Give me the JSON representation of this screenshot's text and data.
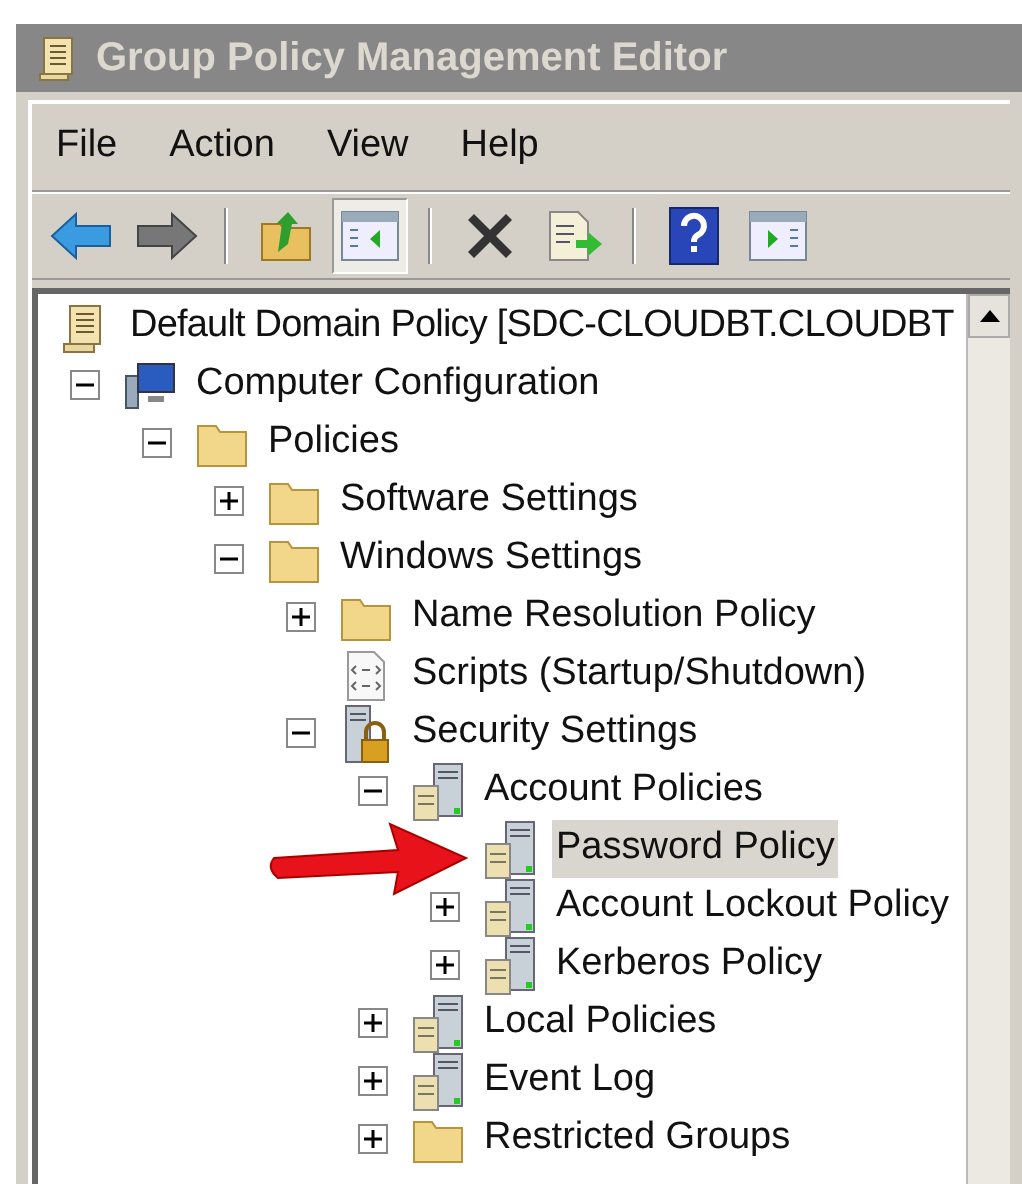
{
  "window": {
    "title": "Group Policy Management Editor"
  },
  "menu": [
    "File",
    "Action",
    "View",
    "Help"
  ],
  "toolbar": [
    {
      "kind": "back",
      "disabled": false
    },
    {
      "kind": "forward",
      "disabled": true
    },
    {
      "kind": "separator"
    },
    {
      "kind": "up"
    },
    {
      "kind": "tree",
      "pressed": true
    },
    {
      "kind": "separator"
    },
    {
      "kind": "delete"
    },
    {
      "kind": "export"
    },
    {
      "kind": "separator"
    },
    {
      "kind": "help"
    },
    {
      "kind": "pane",
      "pressed": false
    }
  ],
  "tree": [
    {
      "label": "Default Domain Policy [SDC-CLOUDBT.CLOUDBT",
      "kind": "scroll",
      "selected": false,
      "children": [
        {
          "label": "Computer Configuration",
          "kind": "computer",
          "expanded": true,
          "selected": false,
          "children": [
            {
              "label": "Policies",
              "kind": "folder",
              "expanded": true,
              "selected": false,
              "children": [
                {
                  "label": "Software Settings",
                  "kind": "folder",
                  "expanded": false,
                  "selected": false
                },
                {
                  "label": "Windows Settings",
                  "kind": "folder",
                  "expanded": true,
                  "selected": false,
                  "children": [
                    {
                      "label": "Name Resolution Policy",
                      "kind": "folder",
                      "expanded": false,
                      "selected": false
                    },
                    {
                      "label": "Scripts (Startup/Shutdown)",
                      "kind": "script",
                      "selected": false
                    },
                    {
                      "label": "Security Settings",
                      "kind": "lock",
                      "expanded": true,
                      "selected": false,
                      "children": [
                        {
                          "label": "Account Policies",
                          "kind": "server",
                          "expanded": true,
                          "selected": false,
                          "children": [
                            {
                              "label": "Password Policy",
                              "kind": "server",
                              "selected": true
                            },
                            {
                              "label": "Account Lockout Policy",
                              "kind": "server",
                              "expanded": false,
                              "selected": false
                            },
                            {
                              "label": "Kerberos Policy",
                              "kind": "server",
                              "expanded": false,
                              "selected": false
                            }
                          ]
                        },
                        {
                          "label": "Local Policies",
                          "kind": "server",
                          "expanded": false,
                          "selected": false
                        },
                        {
                          "label": "Event Log",
                          "kind": "server",
                          "expanded": false,
                          "selected": false
                        },
                        {
                          "label": "Restricted Groups",
                          "kind": "folder",
                          "expanded": false,
                          "selected": false
                        }
                      ]
                    }
                  ]
                }
              ]
            }
          ]
        }
      ]
    }
  ],
  "callout": {
    "kind": "arrow"
  }
}
